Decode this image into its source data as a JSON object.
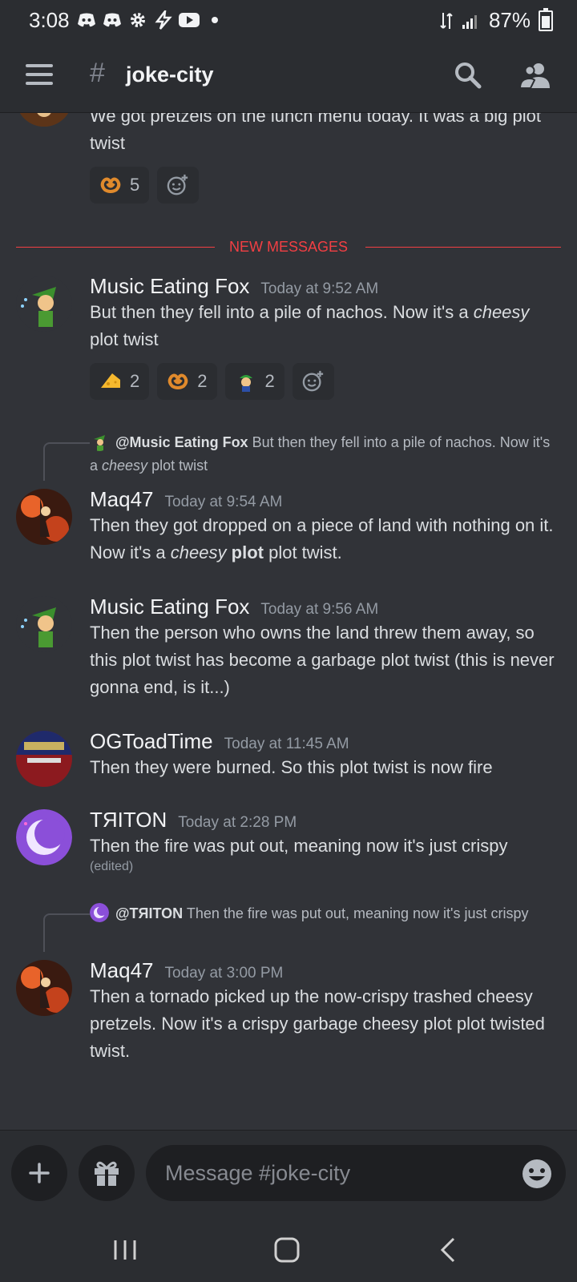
{
  "status_bar": {
    "time": "3:08",
    "battery": "87%",
    "icons": [
      "discord-icon",
      "discord-icon",
      "gear-icon",
      "bolt-icon",
      "youtube-icon",
      "dot-icon"
    ]
  },
  "header": {
    "channel_prefix": "#",
    "channel_name": "joke-city"
  },
  "top_message": {
    "text": "We got pretzels on the lunch menu today. It was a big plot twist",
    "reactions": [
      {
        "emoji": "pretzel",
        "count": "5"
      }
    ]
  },
  "divider": {
    "label": "NEW MESSAGES"
  },
  "messages": [
    {
      "author": "Music Eating Fox",
      "timestamp": "Today at 9:52 AM",
      "text_before": "But then they fell into a pile of nachos. Now it's a ",
      "text_italic": "cheesy",
      "text_after": " plot twist",
      "reactions": [
        {
          "emoji": "cheese",
          "count": "2"
        },
        {
          "emoji": "pretzel",
          "count": "2"
        },
        {
          "emoji": "luigi",
          "count": "2"
        }
      ]
    },
    {
      "reply": {
        "mention": "@Music Eating Fox",
        "text_before": " But then they fell into a pile of nachos. Now it's a ",
        "text_italic": "cheesy",
        "text_after": " plot twist"
      },
      "author": "Maq47",
      "timestamp": "Today at 9:54 AM",
      "text_before": "Then they got dropped on a piece of land with nothing on it. Now it's a ",
      "text_italic": "cheesy",
      "text_bold": "plot",
      "text_after": " plot twist."
    },
    {
      "author": "Music Eating Fox",
      "timestamp": "Today at 9:56 AM",
      "text": "Then the person who owns the land threw them away, so this plot twist has become a garbage plot twist (this is never gonna end, is it...)"
    },
    {
      "author": "OGToadTime",
      "timestamp": "Today at 11:45 AM",
      "text": "Then they were burned. So this plot twist is now fire"
    },
    {
      "author": "TЯITON",
      "timestamp": "Today at 2:28 PM",
      "text": "Then the fire was put out, meaning now it's just crispy",
      "edited": "(edited)"
    },
    {
      "reply": {
        "mention": "@TЯITON",
        "text": " Then the fire was put out, meaning now it's just crispy"
      },
      "author": "Maq47",
      "timestamp": "Today at 3:00 PM",
      "text": "Then a tornado picked up the now-crispy trashed cheesy pretzels. Now it's a crispy garbage cheesy plot plot twisted twist."
    }
  ],
  "composer": {
    "placeholder": "Message #joke-city"
  },
  "colors": {
    "background": "#313338",
    "bar": "#2b2d31",
    "accent_red": "#f23f43"
  }
}
